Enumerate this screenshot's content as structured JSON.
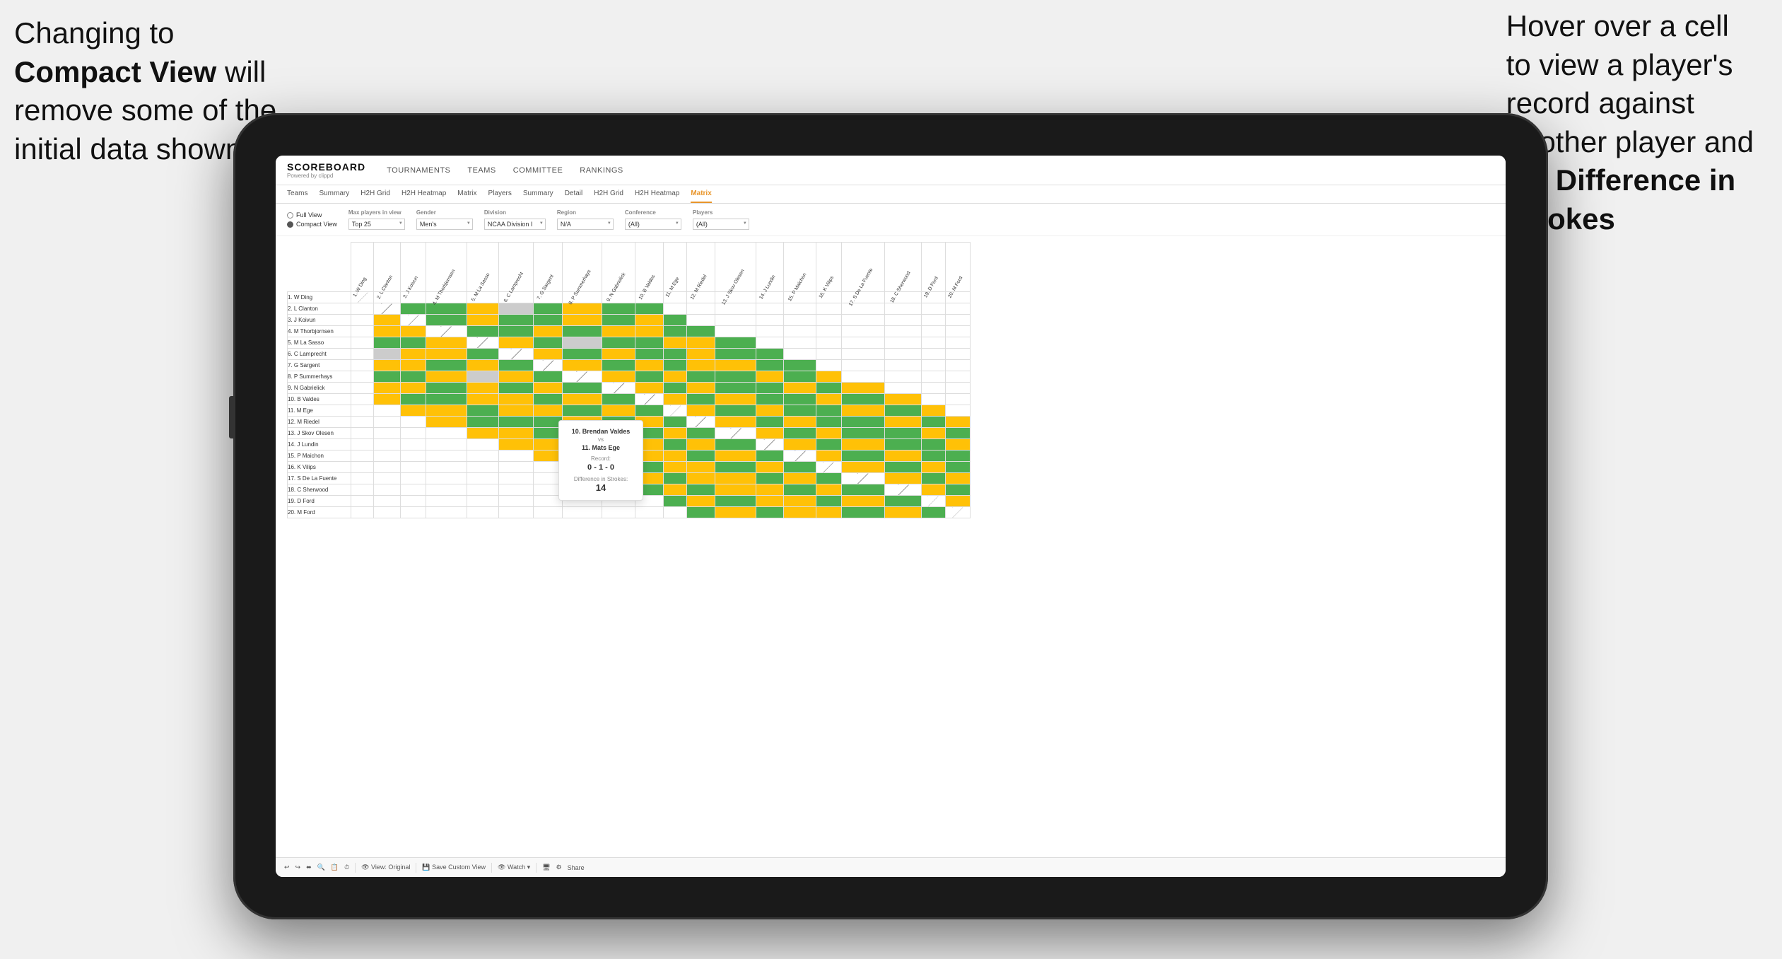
{
  "annotations": {
    "left_text_line1": "Changing to",
    "left_text_bold": "Compact View",
    "left_text_line2": "will",
    "left_text_line3": "remove some of the",
    "left_text_line4": "initial data shown",
    "right_text_line1": "Hover over a cell",
    "right_text_line2": "to view a player's",
    "right_text_line3": "record against",
    "right_text_line4": "another player and",
    "right_text_line5": "the",
    "right_text_bold": "Difference in",
    "right_text_line6": "Strokes"
  },
  "header": {
    "logo": "SCOREBOARD",
    "logo_sub": "Powered by clippd",
    "nav": [
      "TOURNAMENTS",
      "TEAMS",
      "COMMITTEE",
      "RANKINGS"
    ]
  },
  "sub_nav": {
    "items": [
      "Teams",
      "Summary",
      "H2H Grid",
      "H2H Heatmap",
      "Matrix",
      "Players",
      "Summary",
      "Detail",
      "H2H Grid",
      "H2H Heatmap",
      "Matrix"
    ],
    "active_index": 10
  },
  "filters": {
    "view_options": [
      "Full View",
      "Compact View"
    ],
    "selected_view": "Compact View",
    "fields": [
      {
        "label": "Max players in view",
        "value": "Top 25"
      },
      {
        "label": "Gender",
        "value": "Men's"
      },
      {
        "label": "Division",
        "value": "NCAA Division I"
      },
      {
        "label": "Region",
        "value": "N/A"
      },
      {
        "label": "Conference",
        "value": "(All)"
      },
      {
        "label": "Players",
        "value": "(All)"
      }
    ]
  },
  "matrix": {
    "col_headers": [
      "1. W Ding",
      "2. L Clanton",
      "3. J Koivun",
      "4. M Thorbjornsen",
      "5. M La Sasso",
      "6. C Lamprecht",
      "7. G Sargent",
      "8. P Summerhays",
      "9. N Gabrielick",
      "10. B Valdes",
      "11. M Ege",
      "12. M Riedel",
      "13. J Skov Olesen",
      "14. J Lundin",
      "15. P Maichon",
      "16. K Vilips",
      "17. S De La Fuente",
      "18. C Sherwood",
      "19. D Ford",
      "20. M Ford"
    ],
    "row_headers": [
      "1. W Ding",
      "2. L Clanton",
      "3. J Koivun",
      "4. M Thorbjornsen",
      "5. M La Sasso",
      "6. C Lamprecht",
      "7. G Sargent",
      "8. P Summerhays",
      "9. N Gabrielick",
      "10. B Valdes",
      "11. M Ege",
      "12. M Riedel",
      "13. J Skov Olesen",
      "14. J Lundin",
      "15. P Maichon",
      "16. K Vilips",
      "17. S De La Fuente",
      "18. C Sherwood",
      "19. D Ford",
      "20. M Ford"
    ]
  },
  "tooltip": {
    "player1": "10. Brendan Valdes",
    "vs": "vs",
    "player2": "11. Mats Ege",
    "record_label": "Record:",
    "record": "0 - 1 - 0",
    "diff_label": "Difference in Strokes:",
    "diff": "14"
  },
  "toolbar": {
    "items": [
      "↩",
      "↪",
      "⬌",
      "🔍",
      "📋",
      "⏱",
      "👁 View: Original",
      "💾 Save Custom View",
      "👁 Watch ▾",
      "🖥",
      "⚙",
      "Share"
    ]
  }
}
